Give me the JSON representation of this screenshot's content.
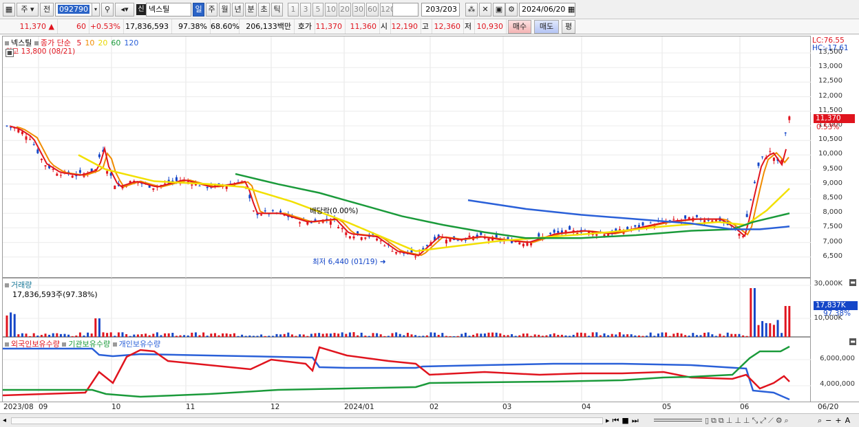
{
  "toolbar": {
    "type_btn": "주",
    "prev_btn": "전",
    "code": "092790",
    "badge": "신",
    "stock_name": "넥스틸",
    "periods": [
      "일",
      "주",
      "월",
      "년",
      "분",
      "초",
      "틱"
    ],
    "active_period": "일",
    "intervals": [
      "1",
      "3",
      "5",
      "10",
      "20",
      "30",
      "60",
      "120"
    ],
    "count": "203",
    "count_total": "/203",
    "date": "2024/06/20"
  },
  "quote": {
    "price": "11,370",
    "arrow": "▲",
    "change": "60",
    "change_pct": "+0.53%",
    "volume": "17,836,593",
    "vol_ratio": "97.38%",
    "turnover": "68.60%",
    "amount": "206,133백만",
    "hoga_label": "호가",
    "ask": "11,370",
    "bid": "11,360",
    "open_label": "시",
    "open": "12,190",
    "high_label": "고",
    "high": "12,360",
    "low_label": "저",
    "low": "10,930",
    "buy_btn": "매수",
    "sell_btn": "매도",
    "eval_btn": "평"
  },
  "price_panel": {
    "legend_name": "넥스틸",
    "legend_ma": "종가 단순",
    "ma_periods": [
      "5",
      "10",
      "20",
      "60",
      "120"
    ],
    "ma_colors": [
      "#e0141e",
      "#f08c00",
      "#e8d800",
      "#1a9a3a",
      "#2a60d8"
    ],
    "high_label": "최고 13,800 (08/21)",
    "low_label": "최저 6,440 (01/19)",
    "dividend_label": "배당락(0.00%)",
    "lc": "LC:76.55",
    "hc": "HC:-17.61",
    "ticks": [
      "13,500",
      "13,000",
      "12,500",
      "12,000",
      "11,500",
      "11,000",
      "10,500",
      "10,000",
      "9,500",
      "9,000",
      "8,500",
      "8,000",
      "7,500",
      "7,000",
      "6,500"
    ],
    "current_price_tag": "11,370",
    "current_pct_tag": "0.53%"
  },
  "volume_panel": {
    "title": "거래량",
    "value": "17,836,593주(97.38%)",
    "ticks": [
      "30,000K",
      "10,000K"
    ],
    "current_tag": "17,837K",
    "current_pct": "97.38%"
  },
  "holding_panel": {
    "legend": [
      "외국인보유수량",
      "기관보유수량",
      "개인보유수량"
    ],
    "colors": [
      "#e0141e",
      "#1a9a3a",
      "#2a60d8"
    ],
    "ticks": [
      "6,000,000",
      "4,000,000"
    ]
  },
  "x_axis": [
    "2023/08",
    "09",
    "10",
    "11",
    "12",
    "2024/01",
    "02",
    "03",
    "04",
    "05",
    "06",
    "06/20"
  ],
  "colors": {
    "up": "#e0141e",
    "down": "#1446c8",
    "accent": "#2a63c7"
  }
}
